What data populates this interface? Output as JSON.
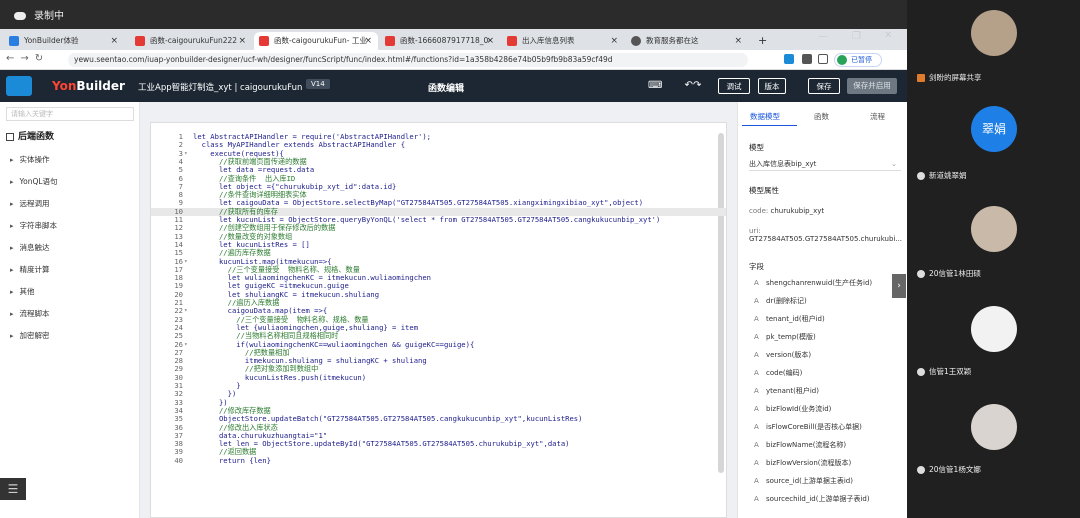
{
  "window": {
    "recording_label": "录制中"
  },
  "tabs": [
    {
      "label": "YonBuilder体验",
      "color": "#2a7de1"
    },
    {
      "label": "函数-caigourukuFun222",
      "color": "#e53935"
    },
    {
      "label": "函数-caigourukuFun- 工业",
      "color": "#e53935"
    },
    {
      "label": "函数-1666087917718_0-",
      "color": "#e53935"
    },
    {
      "label": "出入库信息列表",
      "color": "#e53935"
    },
    {
      "label": "教育服务都在这",
      "color": "#555555"
    }
  ],
  "address": {
    "url": "yewu.seentao.com/iuap-yonbuilder-designer/ucf-wh/designer/funcScript/func/index.html#/functions?id=1a358b4286e74b05b9fb9b83a59cf49d",
    "profile": "已暂停"
  },
  "header": {
    "logo_a": "Yon",
    "logo_b": "Builder",
    "app_name": "工业App智能灯制造_xyt | caigourukuFun",
    "version": "V14",
    "center_title": "函数编辑",
    "buttons": {
      "debug": "调试",
      "version": "版本",
      "save": "保存",
      "publish": "保存并启用"
    }
  },
  "left": {
    "search_placeholder": "请输入关键字",
    "heading": "后端函数",
    "items": [
      "实体操作",
      "YonQL语句",
      "远程调用",
      "字符串脚本",
      "消息触达",
      "精度计算",
      "其他",
      "流程脚本",
      "加密解密"
    ]
  },
  "code": [
    {
      "n": "1",
      "fold": "",
      "t": "let AbstractAPIHandler = require('AbstractAPIHandler');",
      "cls": ""
    },
    {
      "n": "2",
      "fold": "",
      "t": "  class MyAPIHandler extends AbstractAPIHandler {",
      "cls": ""
    },
    {
      "n": "3",
      "fold": "▾",
      "t": "    execute(request){",
      "cls": ""
    },
    {
      "n": "4",
      "fold": "",
      "t": "      //获取前端页面传递的数据",
      "cls": "cm"
    },
    {
      "n": "5",
      "fold": "",
      "t": "      let data =request.data",
      "cls": ""
    },
    {
      "n": "6",
      "fold": "",
      "t": "      //查询条件  出入库ID",
      "cls": "cm"
    },
    {
      "n": "7",
      "fold": "",
      "t": "      let object ={\"churukubip_xyt_id\":data.id}",
      "cls": ""
    },
    {
      "n": "8",
      "fold": "",
      "t": "      //条件查询详细明细表实体",
      "cls": "cm"
    },
    {
      "n": "9",
      "fold": "",
      "t": "      let caigouData = ObjectStore.selectByMap(\"GT27584AT505.GT27584AT505.xiangximingxibiao_xyt\",object)",
      "cls": ""
    },
    {
      "n": "10",
      "fold": "",
      "t": "      //获取所有的库存",
      "cls": "cm hl"
    },
    {
      "n": "11",
      "fold": "",
      "t": "      let kucunList = ObjectStore.queryByYonQL('select * from GT27584AT505.GT27584AT505.cangkukucunbip_xyt')",
      "cls": ""
    },
    {
      "n": "12",
      "fold": "",
      "t": "      //创建空数组用于保存修改后的数据",
      "cls": "cm"
    },
    {
      "n": "13",
      "fold": "",
      "t": "      //数量改变的对象数组",
      "cls": "cm"
    },
    {
      "n": "14",
      "fold": "",
      "t": "      let kucunListRes = []",
      "cls": ""
    },
    {
      "n": "15",
      "fold": "",
      "t": "      //遍历库存数据",
      "cls": "cm"
    },
    {
      "n": "16",
      "fold": "▾",
      "t": "      kucunList.map(itmekucun=>{",
      "cls": ""
    },
    {
      "n": "17",
      "fold": "",
      "t": "        //三个变量接受  物料名称、规格、数量",
      "cls": "cm"
    },
    {
      "n": "18",
      "fold": "",
      "t": "        let wuliaomingchenKC = itmekucun.wuliaomingchen",
      "cls": ""
    },
    {
      "n": "19",
      "fold": "",
      "t": "        let guigeKC =itmekucun.guige",
      "cls": ""
    },
    {
      "n": "20",
      "fold": "",
      "t": "        let shuliangKC = itmekucun.shuliang",
      "cls": ""
    },
    {
      "n": "21",
      "fold": "",
      "t": "        //遍历入库数据",
      "cls": "cm"
    },
    {
      "n": "22",
      "fold": "▾",
      "t": "        caigouData.map(item =>{",
      "cls": ""
    },
    {
      "n": "23",
      "fold": "",
      "t": "          //三个变量接受  物料名称、规格、数量",
      "cls": "cm"
    },
    {
      "n": "24",
      "fold": "",
      "t": "          let {wuliaomingchen,guige,shuliang} = item",
      "cls": ""
    },
    {
      "n": "25",
      "fold": "",
      "t": "          //当物料名称相同且规格相同时",
      "cls": "cm"
    },
    {
      "n": "26",
      "fold": "▾",
      "t": "          if(wuliaomingchenKC==wuliaomingchen && guigeKC==guige){",
      "cls": ""
    },
    {
      "n": "27",
      "fold": "",
      "t": "            //把数量相加",
      "cls": "cm"
    },
    {
      "n": "28",
      "fold": "",
      "t": "            itmekucun.shuliang = shuliangKC + shuliang",
      "cls": ""
    },
    {
      "n": "29",
      "fold": "",
      "t": "            //把对象添加到数组中",
      "cls": "cm"
    },
    {
      "n": "30",
      "fold": "",
      "t": "            kucunListRes.push(itmekucun)",
      "cls": ""
    },
    {
      "n": "31",
      "fold": "",
      "t": "          }",
      "cls": ""
    },
    {
      "n": "32",
      "fold": "",
      "t": "        })",
      "cls": ""
    },
    {
      "n": "33",
      "fold": "",
      "t": "      })",
      "cls": ""
    },
    {
      "n": "34",
      "fold": "",
      "t": "      //修改库存数据",
      "cls": "cm"
    },
    {
      "n": "35",
      "fold": "",
      "t": "      ObjectStore.updateBatch(\"GT27584AT505.GT27584AT505.cangkukucunbip_xyt\",kucunListRes)",
      "cls": ""
    },
    {
      "n": "36",
      "fold": "",
      "t": "      //修改出入库状态",
      "cls": "cm"
    },
    {
      "n": "37",
      "fold": "",
      "t": "      data.churukuzhuangtai=\"1\"",
      "cls": ""
    },
    {
      "n": "38",
      "fold": "",
      "t": "      let len = ObjectStore.updateById(\"GT27584AT505.GT27584AT505.churukubip_xyt\",data)",
      "cls": ""
    },
    {
      "n": "39",
      "fold": "",
      "t": "      //返回数据",
      "cls": "cm"
    },
    {
      "n": "40",
      "fold": "",
      "t": "      return {len}",
      "cls": ""
    }
  ],
  "right": {
    "tabs": [
      "数据模型",
      "函数",
      "流程"
    ],
    "model_label": "模型",
    "model_value": "出入库信息表bip_xyt",
    "attr_label": "模型属性",
    "code_label": "code:",
    "code_value": "churukubip_xyt",
    "uri_label": "uri:",
    "uri_value": "GT27584AT505.GT27584AT505.churukubi...",
    "fields_label": "字段",
    "fields": [
      "shengchanrenwuid(生产任务id)",
      "dr(删除标记)",
      "tenant_id(租户id)",
      "pk_temp(模版)",
      "version(版本)",
      "code(编码)",
      "ytenant(租户id)",
      "bizFlowId(业务流id)",
      "isFlowCoreBill(是否核心单据)",
      "bizFlowName(流程名称)",
      "bizFlowVersion(流程版本)",
      "source_id(上游单据主表id)",
      "sourcechild_id(上游单据子表id)"
    ]
  },
  "video": {
    "top_user": "剑盼的屏幕共享",
    "users": [
      {
        "name": "新道姚翠娟",
        "avatar_text": "翠娟",
        "color": "#1e7fe6"
      },
      {
        "name": "20信管1林田硕",
        "avatar_text": "",
        "color": "#c9b9a8"
      },
      {
        "name": "信管1王双颖",
        "avatar_text": "",
        "color": "#f2f2f2"
      },
      {
        "name": "20信管1杨文娜",
        "avatar_text": "",
        "color": "#d9d4cf"
      }
    ]
  }
}
